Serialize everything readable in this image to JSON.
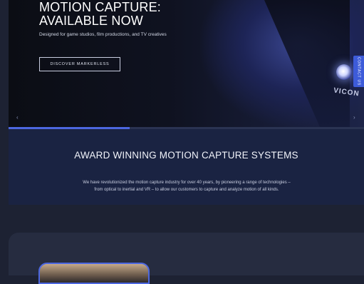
{
  "hero": {
    "title_line1": "MOTION CAPTURE:",
    "title_line2": "AVAILABLE NOW",
    "subtitle": "Designed for game studios, film productions, and TV creatives",
    "cta_label": "DISCOVER MARKERLESS",
    "brand_mark": "VICON",
    "side_tab_label": "CONTACT US",
    "arrow_left": "‹",
    "arrow_right": "›",
    "slide_progress": 0.34
  },
  "award": {
    "title": "AWARD WINNING MOTION CAPTURE SYSTEMS",
    "body": "We have revolutionized the motion capture industry for over 40 years, by pioneering a range of technologies – from optical to inertial and VR – to allow our customers to capture and analyze motion of all kinds."
  },
  "colors": {
    "accent": "#4c67e0",
    "page_background": "#1d2233",
    "section_background": "#1a2342"
  }
}
